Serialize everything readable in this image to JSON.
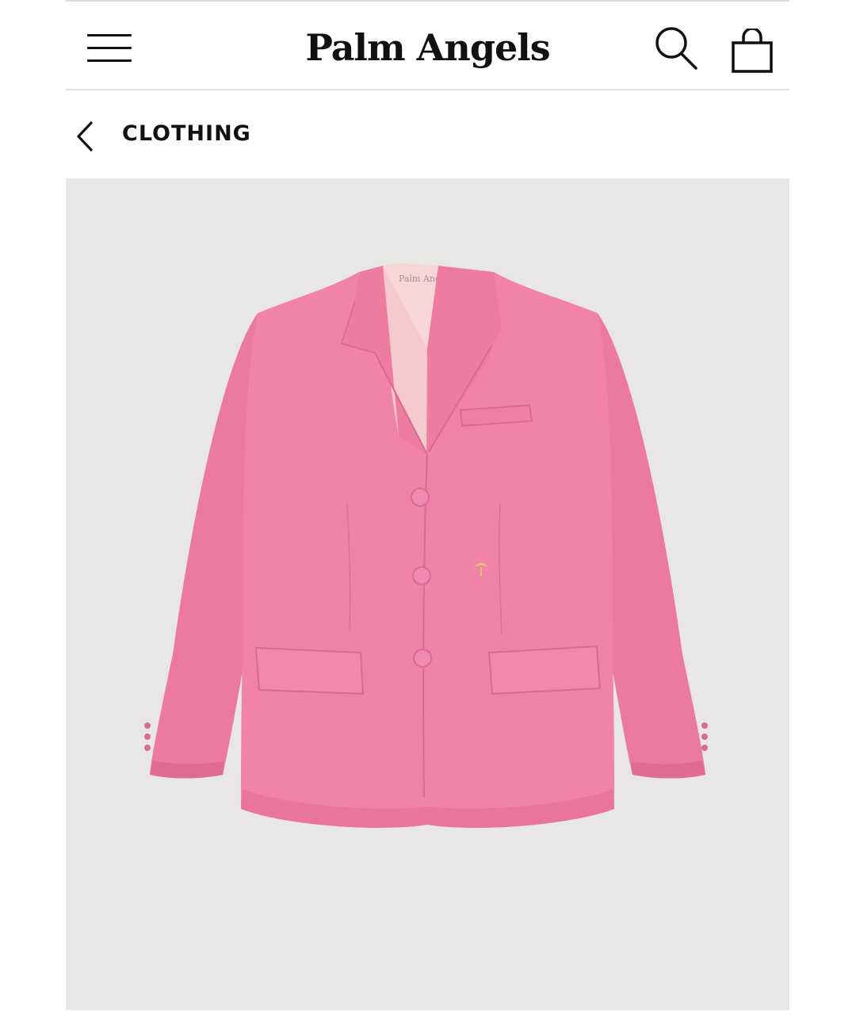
{
  "header": {
    "brand": "Palm Angels",
    "menu_icon": "hamburger-menu-icon",
    "search_icon": "search-icon",
    "bag_icon": "shopping-bag-icon"
  },
  "breadcrumb": {
    "back_icon": "chevron-left-icon",
    "label": "CLOTHING"
  },
  "product": {
    "image_subject": "pink single-breasted blazer",
    "label_text": "Palm Angels"
  },
  "colors": {
    "background": "#ffffff",
    "image_backdrop": "#e9e7e5",
    "blazer_pink": "#ef7fa3",
    "lining": "#f6c9cb",
    "text": "#111111"
  }
}
